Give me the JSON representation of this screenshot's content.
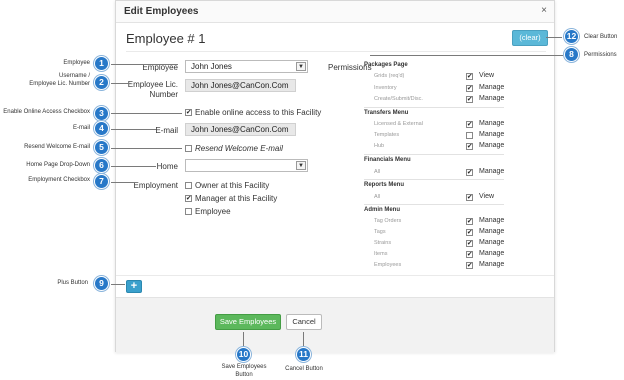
{
  "dialog": {
    "title": "Edit Employees",
    "close_label": "×"
  },
  "heading": "Employee # 1",
  "clear_label": "(clear)",
  "form": {
    "employee_label": "Employee",
    "employee_value": "John Jones",
    "username_label": "Employee Lic.\nNumber",
    "username_value": "John Jones@CanCon.Com",
    "online_access_label": "Enable online access to this Facility",
    "email_label": "E-mail",
    "email_value": "John Jones@CanCon.Com",
    "resend_label": "Resend Welcome E-mail",
    "home_label": "Home",
    "home_value": "",
    "employment_label": "Employment",
    "employment_options": [
      {
        "label": "Owner at this Facility",
        "checked": false
      },
      {
        "label": "Manager at this Facility",
        "checked": true
      },
      {
        "label": "Employee",
        "checked": false
      }
    ]
  },
  "permissions": {
    "label": "Permissions",
    "sections": [
      {
        "title": "Packages Page",
        "items": [
          {
            "name": "Grids (req'd)",
            "value": "View",
            "checked": true
          },
          {
            "name": "Inventory",
            "value": "Manage",
            "checked": true
          },
          {
            "name": "Create/Submit/Disc.",
            "value": "Manage",
            "checked": true
          }
        ]
      },
      {
        "title": "Transfers Menu",
        "items": [
          {
            "name": "Licensed & External",
            "value": "Manage",
            "checked": true
          },
          {
            "name": "Templates",
            "value": "Manage",
            "checked": false
          },
          {
            "name": "Hub",
            "value": "Manage",
            "checked": true
          }
        ]
      },
      {
        "title": "Financials Menu",
        "items": [
          {
            "name": "All",
            "value": "Manage",
            "checked": true
          }
        ]
      },
      {
        "title": "Reports Menu",
        "items": [
          {
            "name": "All",
            "value": "View",
            "checked": true
          }
        ]
      },
      {
        "title": "Admin Menu",
        "items": [
          {
            "name": "Tag Orders",
            "value": "Manage",
            "checked": true
          },
          {
            "name": "Tags",
            "value": "Manage",
            "checked": true
          },
          {
            "name": "Strains",
            "value": "Manage",
            "checked": true
          },
          {
            "name": "Items",
            "value": "Manage",
            "checked": true
          },
          {
            "name": "Employees",
            "value": "Manage",
            "checked": true
          }
        ]
      }
    ]
  },
  "plus_label": "+",
  "save_label": "Save Employees",
  "cancel_label": "Cancel",
  "callouts": {
    "c1": {
      "num": "1",
      "text": "Employee"
    },
    "c2": {
      "num": "2",
      "text": "Username /\nEmployee Lic. Number"
    },
    "c3": {
      "num": "3",
      "text": "Enable Online Access Checkbox"
    },
    "c4": {
      "num": "4",
      "text": "E-mail"
    },
    "c5": {
      "num": "5",
      "text": "Resend Welcome E-mail"
    },
    "c6": {
      "num": "6",
      "text": "Home Page Drop-Down"
    },
    "c7": {
      "num": "7",
      "text": "Employment Checkbox"
    },
    "c8": {
      "num": "8",
      "text": "Permissions"
    },
    "c9": {
      "num": "9",
      "text": "Plus Button"
    },
    "c10": {
      "num": "10",
      "text": "Save Employees\nButton"
    },
    "c11": {
      "num": "11",
      "text": "Cancel Button"
    },
    "c12": {
      "num": "12",
      "text": "Clear Button"
    }
  }
}
